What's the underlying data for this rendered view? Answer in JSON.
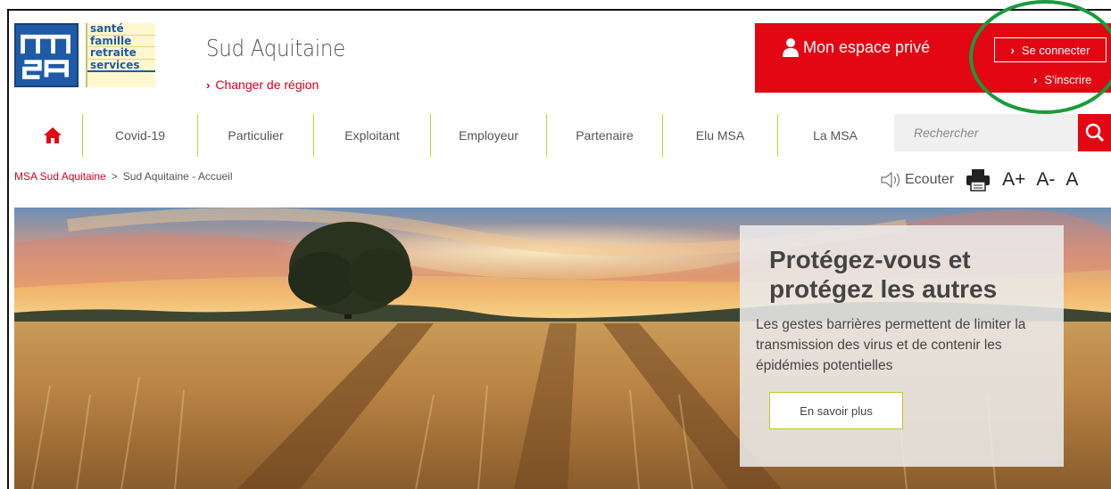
{
  "logo": {
    "words": [
      "santé",
      "famille",
      "retraite",
      "services"
    ]
  },
  "header": {
    "region_title": "Sud Aquitaine",
    "change_region": "Changer de région"
  },
  "private_space": {
    "title": "Mon espace privé",
    "connect_label": "Se connecter",
    "register_label": "S'inscrire"
  },
  "nav": {
    "items": [
      "Covid-19",
      "Particulier",
      "Exploitant",
      "Employeur",
      "Partenaire",
      "Elu MSA",
      "La MSA"
    ],
    "search_placeholder": "Rechercher"
  },
  "breadcrumb": {
    "root": "MSA Sud Aquitaine",
    "separator": ">",
    "current": "Sud Aquitaine - Accueil"
  },
  "tools": {
    "listen_label": "Ecouter",
    "font_increase": "A+",
    "font_decrease": "A-",
    "font_reset": "A"
  },
  "banner": {
    "title": "Protégez-vous et protégez les autres",
    "text": "Les gestes barrières permettent de limiter la transmission des virus et de contenir les épidémies potentielles",
    "button_label": "En savoir plus"
  },
  "colors": {
    "brand_red": "#e30613",
    "nav_separator": "#c7d437",
    "msa_blue": "#1f5aa7",
    "annotation_green": "#1a9a3c"
  }
}
